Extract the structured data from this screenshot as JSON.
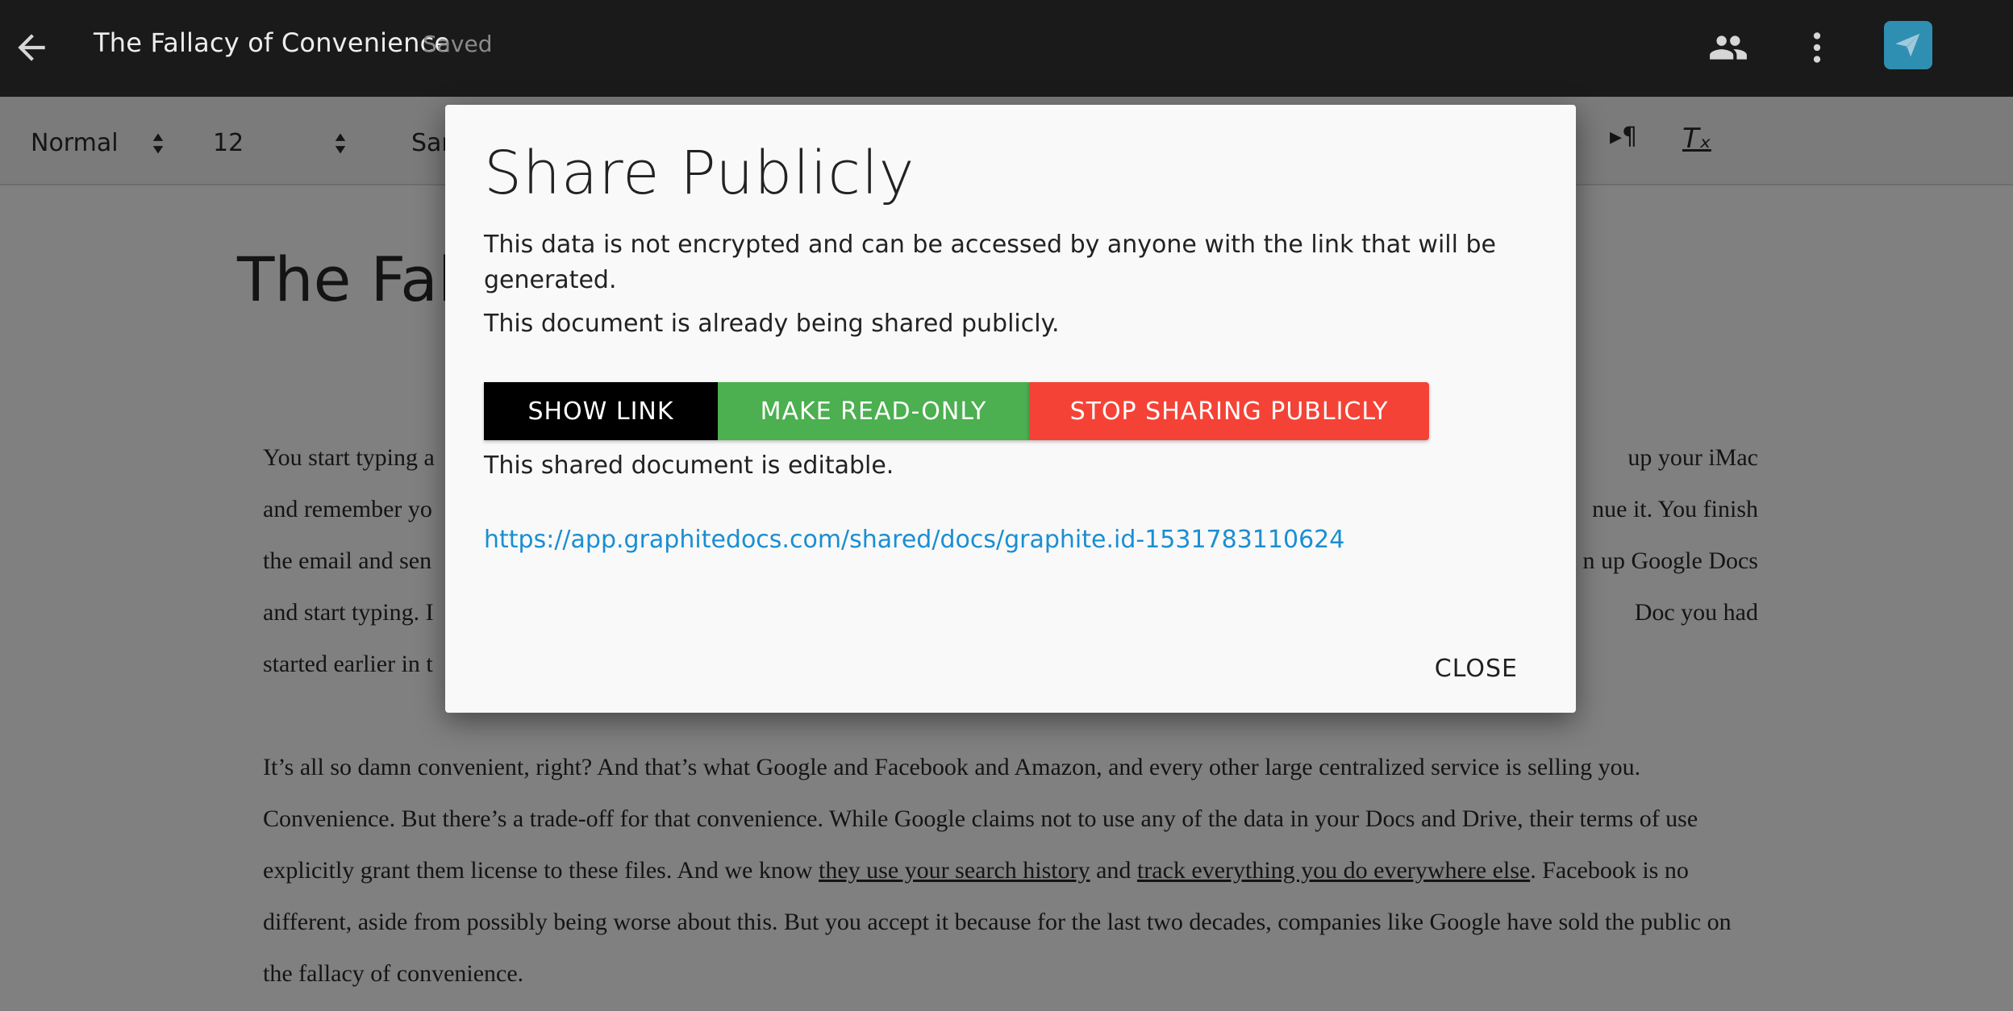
{
  "app_bar": {
    "doc_title": "The Fallacy of Convenience",
    "save_status": "Saved",
    "icons": {
      "back": "arrow-left-icon",
      "collaborators": "people-icon",
      "more": "more-vert-icon",
      "send": "paper-plane-icon"
    },
    "send_button_color": "#2e8fb2"
  },
  "toolbar": {
    "style_select": "Normal",
    "size_select": "12",
    "font_select_partial": "Sar",
    "rtl_icon": "▸¶",
    "clear_format_icon": "Tₓ"
  },
  "document": {
    "heading_partial": "The Fall",
    "paragraph1": {
      "line1_left": "You start typing a",
      "line1_right": "up your iMac",
      "line2_left": "and remember yo",
      "line2_right": "nue it. You finish",
      "line3_left": "the email and sen",
      "line3_right": "n up Google Docs",
      "line4_left": "and start typing. I",
      "line4_right": "Doc you had",
      "line5_left": "started earlier in t"
    },
    "paragraph2": {
      "text_a": "It’s all so damn convenient, right? And that’s what Google and Facebook and Amazon, and every other large centralized service is selling you. Convenience. But there’s a trade-off for that convenience. While Google claims not to use any of the data in your Docs and Drive, their terms of use explicitly grant them license to these files. And we know ",
      "link1": "they use your search history",
      "text_b": " and ",
      "link2": "track everything you do everywhere else",
      "text_c": ". Facebook is no different, aside from possibly being worse about this. But you accept it because for the last two decades, companies like Google have sold the public on the fallacy of convenience."
    }
  },
  "modal": {
    "title": "Share Publicly",
    "warning": "This data is not encrypted and can be accessed by anyone with the link that will be generated.",
    "status": "This document is already being shared publicly.",
    "buttons": {
      "show_link": "SHOW LINK",
      "make_read_only": "MAKE READ-ONLY",
      "stop_sharing": "STOP SHARING PUBLICLY"
    },
    "editable_status": "This shared document is editable.",
    "share_url": "https://app.graphitedocs.com/shared/docs/graphite.id-1531783110624",
    "close_label": "CLOSE",
    "colors": {
      "show_link": "#000000",
      "read_only": "#4caf50",
      "stop_sharing": "#f44336",
      "link": "#1a8ed3"
    }
  }
}
